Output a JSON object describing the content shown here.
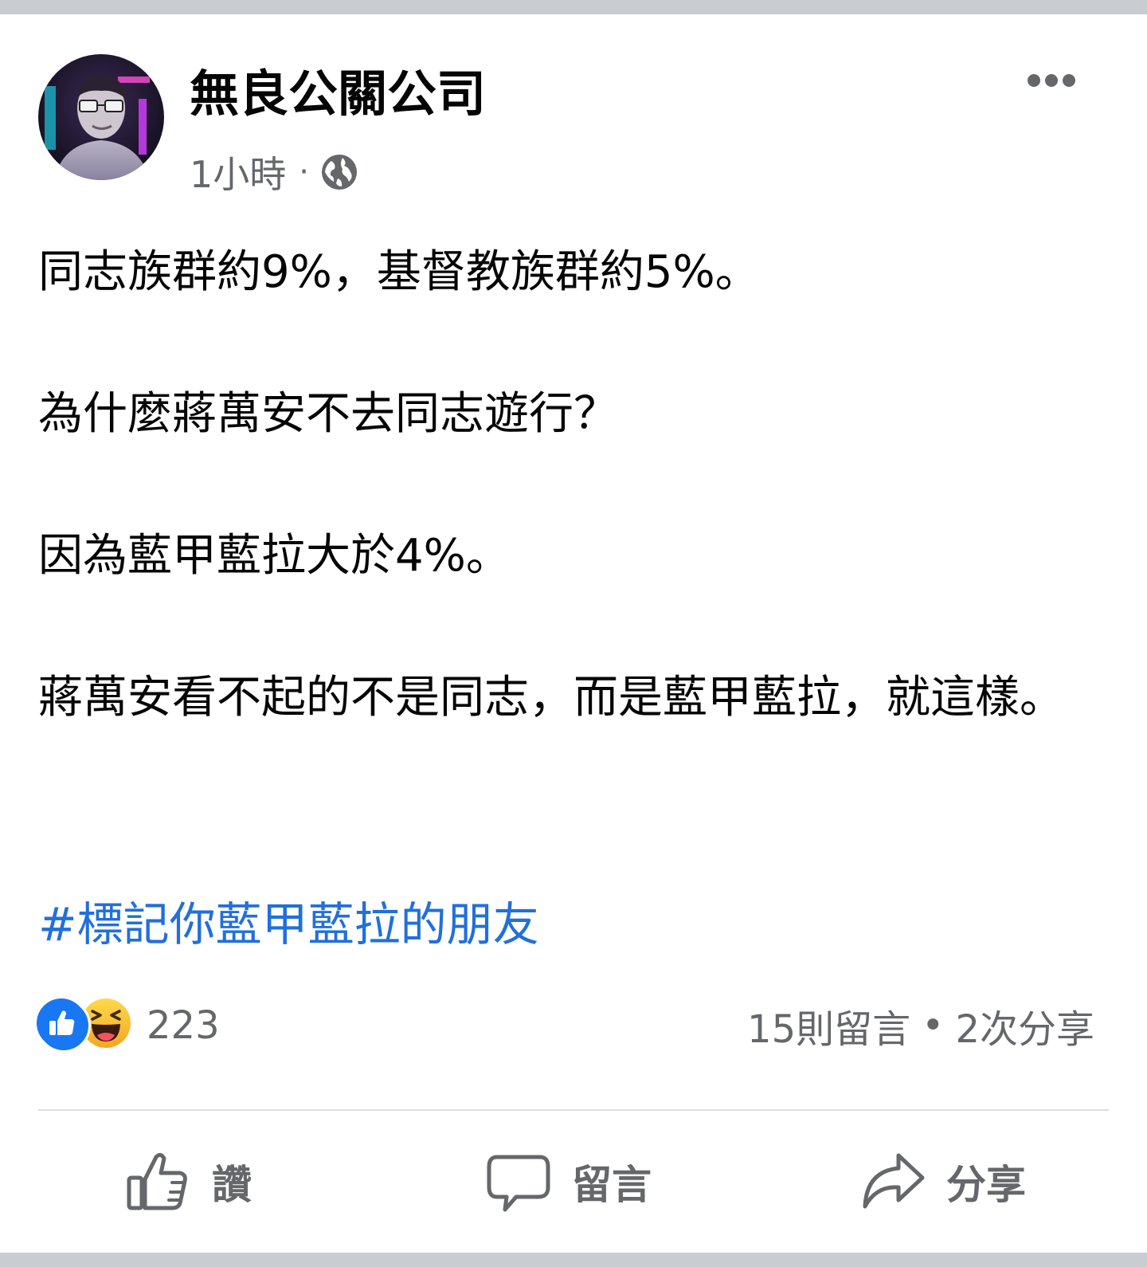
{
  "post": {
    "author": "無良公關公司",
    "time": "1小時",
    "meta_separator": "·",
    "privacy_icon": "globe-icon",
    "paragraphs": [
      "同志族群約9%，基督教族群約5%。",
      "為什麼蔣萬安不去同志遊行？",
      "因為藍甲藍拉大於4%。",
      "蔣萬安看不起的不是同志，而是藍甲藍拉，就這樣。"
    ],
    "hashtag": "#標記你藍甲藍拉的朋友"
  },
  "stats": {
    "reactions": [
      "like",
      "haha"
    ],
    "reaction_count": "223",
    "comments": "15則留言",
    "separator": "•",
    "shares": "2次分享"
  },
  "actions": {
    "like_label": "讚",
    "comment_label": "留言",
    "share_label": "分享"
  },
  "colors": {
    "link": "#216fdb",
    "secondary_text": "#65676b",
    "like_blue": "#1877f2",
    "background_band": "#c9ccd1"
  }
}
